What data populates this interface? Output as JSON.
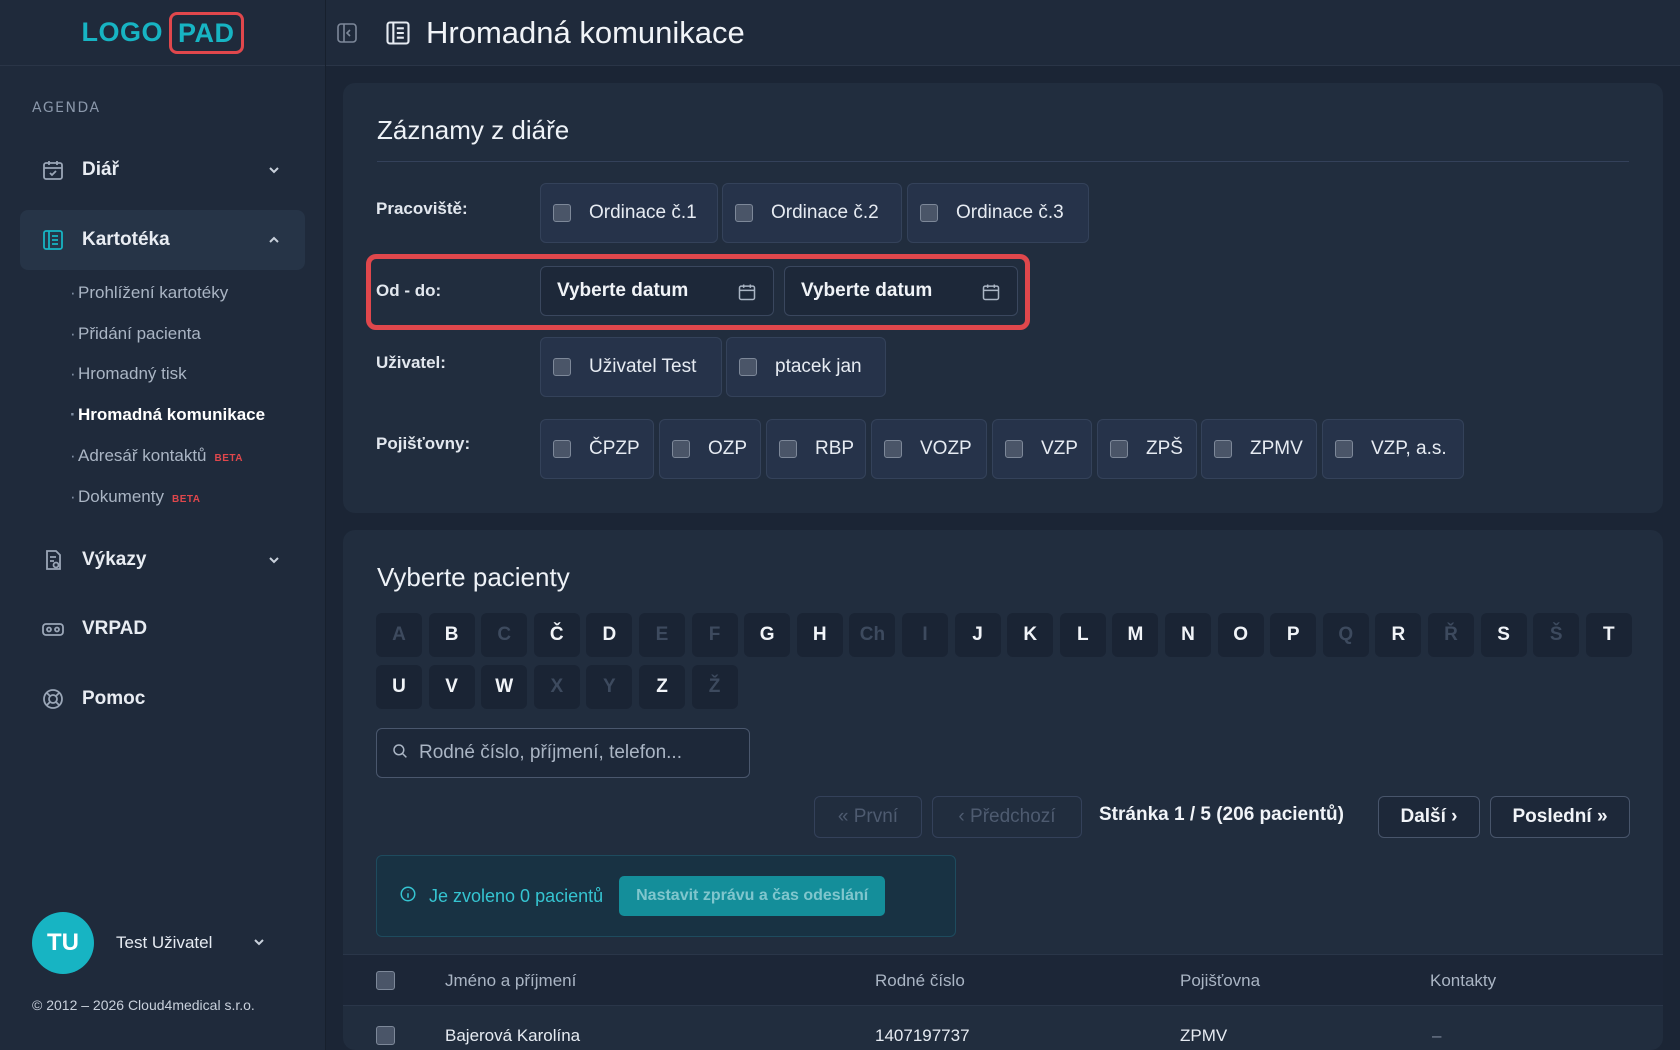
{
  "logo": {
    "part1": "LOGO",
    "part2": "PAD"
  },
  "sidebar": {
    "section": "AGENDA",
    "items": [
      {
        "label": "Diář"
      },
      {
        "label": "Kartotéka"
      },
      {
        "label": "Výkazy"
      },
      {
        "label": "VRPAD"
      },
      {
        "label": "Pomoc"
      }
    ],
    "sub": [
      {
        "label": "Prohlížení kartotéky"
      },
      {
        "label": "Přidání pacienta"
      },
      {
        "label": "Hromadný tisk"
      },
      {
        "label": "Hromadná komunikace"
      },
      {
        "label": "Adresář kontaktů",
        "badge": "BETA"
      },
      {
        "label": "Dokumenty",
        "badge": "BETA"
      }
    ],
    "user": {
      "initials": "TU",
      "name": "Test Uživatel"
    },
    "copyright": "© 2012 – 2026 Cloud4medical s.r.o."
  },
  "header": {
    "title": "Hromadná komunikace"
  },
  "filters": {
    "title": "Záznamy z diáře",
    "workplace_label": "Pracoviště:",
    "workplaces": [
      "Ordinace č.1",
      "Ordinace č.2",
      "Ordinace č.3"
    ],
    "date_label": "Od - do:",
    "date_from": "Vyberte datum",
    "date_to": "Vyberte datum",
    "user_label": "Uživatel:",
    "users": [
      "Uživatel Test",
      "ptacek jan"
    ],
    "insurers_label": "Pojišťovny:",
    "insurers": [
      "ČPZP",
      "OZP",
      "RBP",
      "VOZP",
      "VZP",
      "ZPŠ",
      "ZPMV",
      "VZP, a.s."
    ]
  },
  "patients": {
    "title": "Vyberte pacienty",
    "letters_row1": [
      "A",
      "B",
      "C",
      "Č",
      "D",
      "E",
      "F",
      "G",
      "H",
      "Ch",
      "I",
      "J",
      "K",
      "L",
      "M",
      "N",
      "O",
      "P",
      "Q",
      "R",
      "Ř",
      "S",
      "Š",
      "T"
    ],
    "letters_row2": [
      "U",
      "V",
      "W",
      "X",
      "Y",
      "Z",
      "Ž"
    ],
    "disabled_letters": [
      "A",
      "C",
      "E",
      "F",
      "Ch",
      "I",
      "Q",
      "Ř",
      "Š",
      "X",
      "Y",
      "Ž"
    ],
    "search_placeholder": "Rodné číslo, příjmení, telefon...",
    "pagination": {
      "first": "« První",
      "prev": "‹ Předchozí",
      "info": "Stránka 1 / 5 (206 pacientů)",
      "next": "Další ›",
      "last": "Poslední »"
    },
    "selected_text": "Je zvoleno 0 pacientů",
    "set_message_button": "Nastavit zprávu a čas odeslání",
    "columns": [
      "Jméno a příjmení",
      "Rodné číslo",
      "Pojišťovna",
      "Kontakty"
    ],
    "rows": [
      {
        "name": "Bajerová Karolína",
        "rc": "1407197737",
        "insurer": "ZPMV",
        "contacts": "–"
      }
    ]
  }
}
